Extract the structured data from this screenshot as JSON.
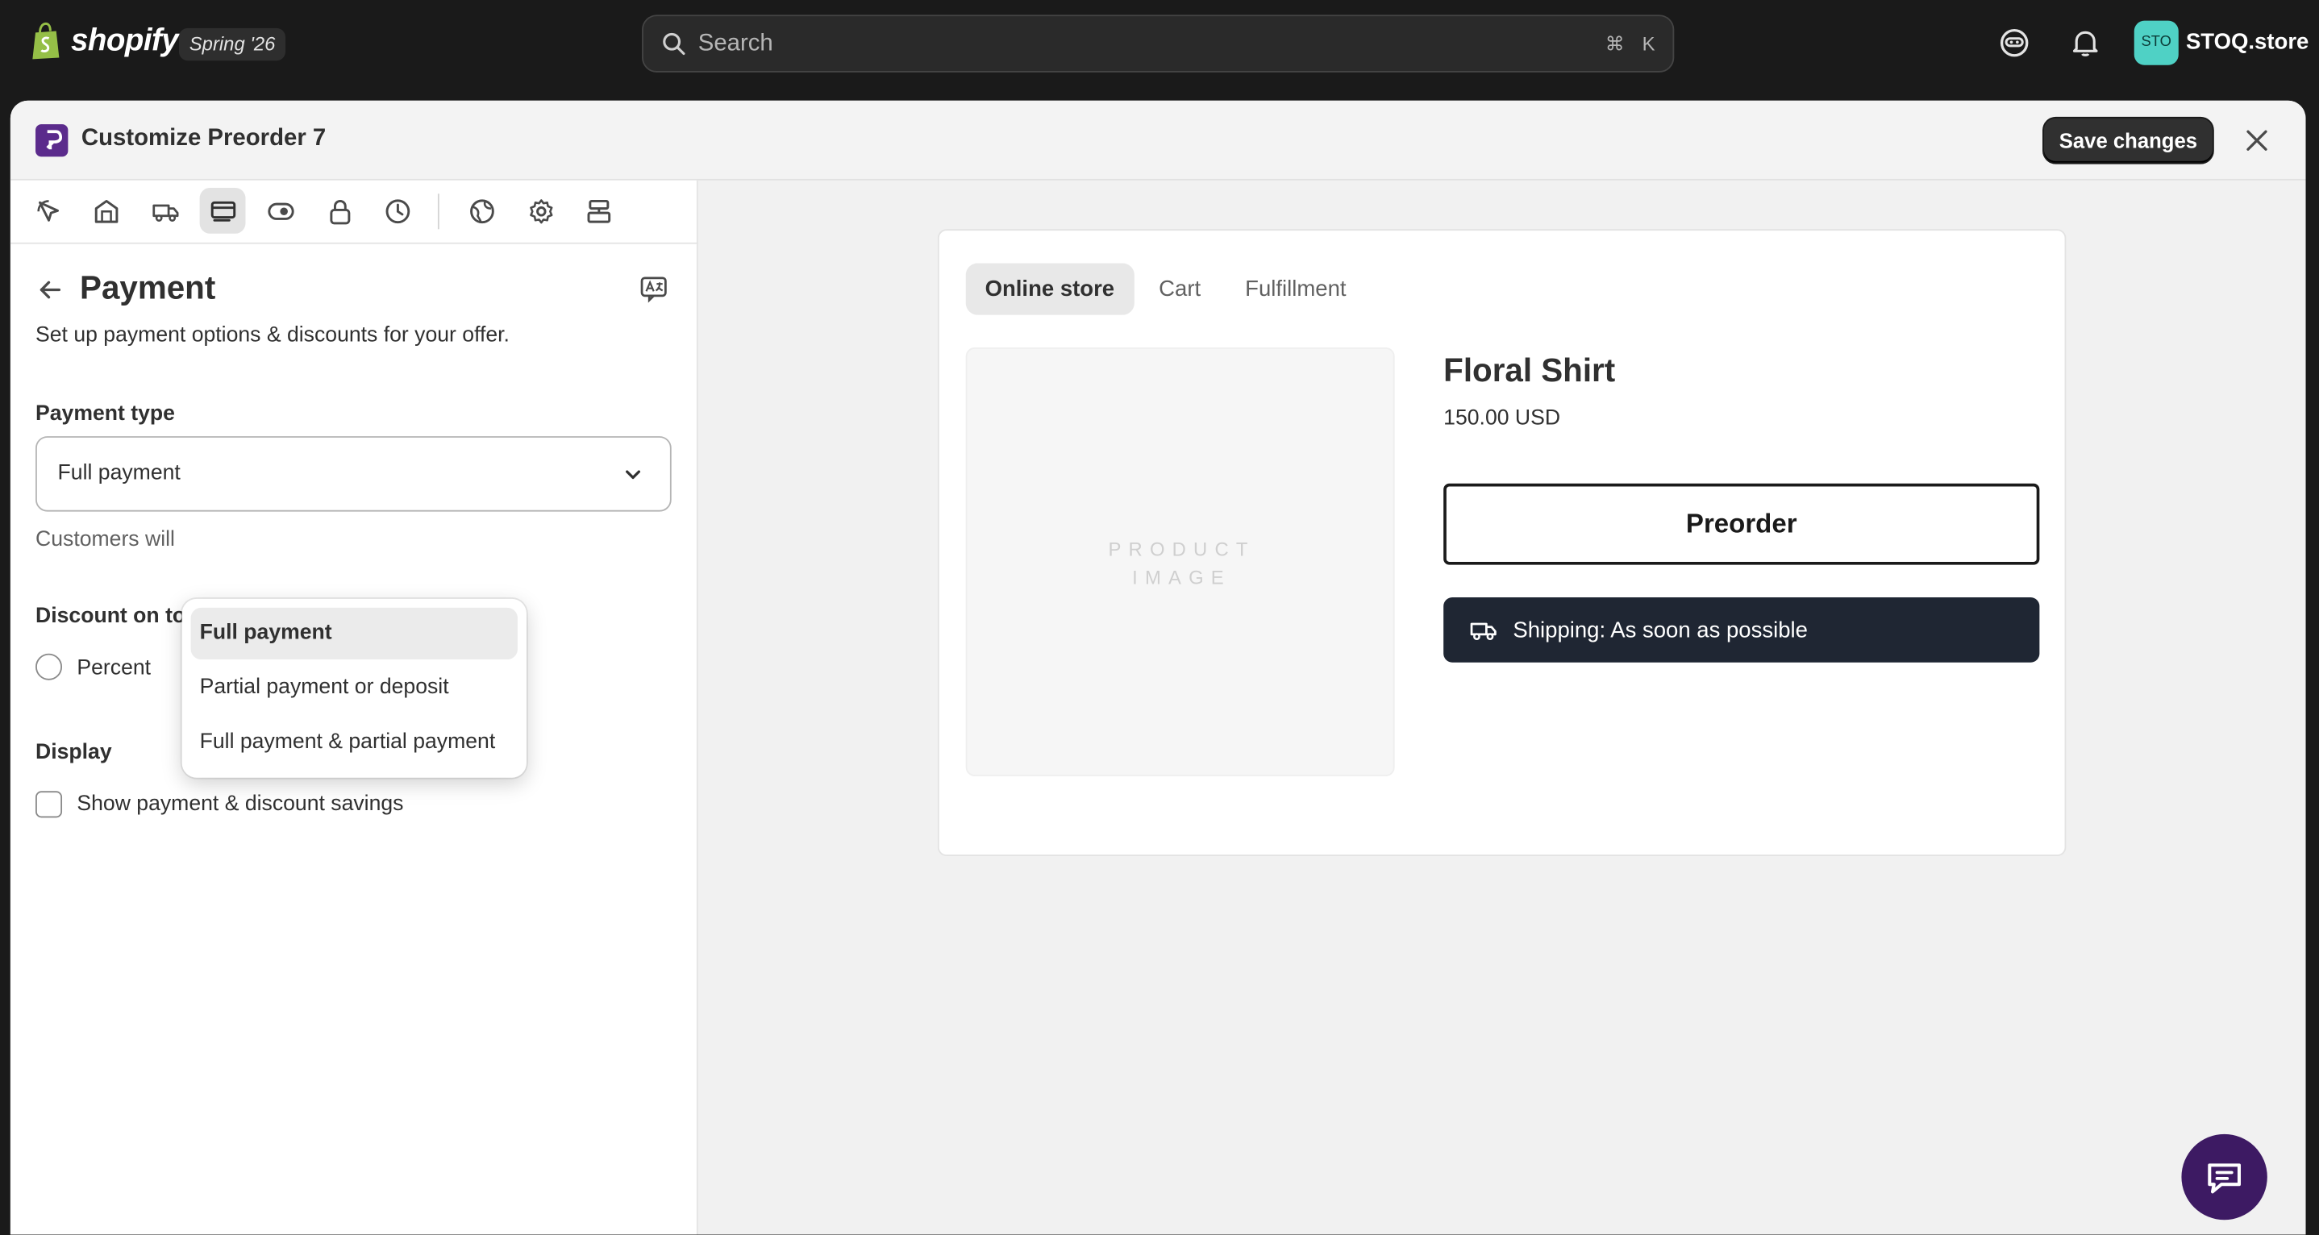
{
  "topbar": {
    "brand": "shopify",
    "version": "Spring '26",
    "search_placeholder": "Search",
    "shortcut_cmd": "⌘",
    "shortcut_key": "K",
    "avatar_initials": "STO",
    "store_name": "STOQ.store"
  },
  "modal": {
    "title": "Customize Preorder 7",
    "save_label": "Save changes"
  },
  "icon_bar": [
    {
      "name": "appearance-icon"
    },
    {
      "name": "store-icon"
    },
    {
      "name": "shipping-icon"
    },
    {
      "name": "payment-icon",
      "active": true
    },
    {
      "name": "visibility-icon"
    },
    {
      "name": "lock-icon"
    },
    {
      "name": "clock-icon"
    },
    {
      "name": "globe-icon"
    },
    {
      "name": "settings-icon"
    },
    {
      "name": "layout-icon"
    }
  ],
  "panel": {
    "title": "Payment",
    "subtitle": "Set up payment options & discounts for your offer.",
    "payment_type_label": "Payment type",
    "payment_type_value": "Full payment",
    "help_text": "Customers will",
    "discount_label": "Discount on to",
    "percent_label": "Percent",
    "display_label": "Display",
    "show_savings_label": "Show payment & discount savings"
  },
  "dropdown": {
    "options": [
      {
        "label": "Full payment",
        "selected": true
      },
      {
        "label": "Partial payment or deposit",
        "selected": false
      },
      {
        "label": "Full payment & partial payment",
        "selected": false
      }
    ]
  },
  "preview": {
    "tabs": [
      {
        "label": "Online store",
        "active": true
      },
      {
        "label": "Cart",
        "active": false
      },
      {
        "label": "Fulfillment",
        "active": false
      }
    ],
    "image_placeholder_line1": "PRODUCT",
    "image_placeholder_line2": "IMAGE",
    "product_name": "Floral Shirt",
    "price": "150.00 USD",
    "preorder_label": "Preorder",
    "shipping_text": "Shipping: As soon as possible"
  },
  "colors": {
    "topbar_bg": "#1a1a1a",
    "save_bg": "#303030",
    "shipping_bg": "#1f2633",
    "chat_bg": "#3d1a63",
    "avatar_bg": "#4fd1c5",
    "app_icon": "#5b2b8c"
  }
}
